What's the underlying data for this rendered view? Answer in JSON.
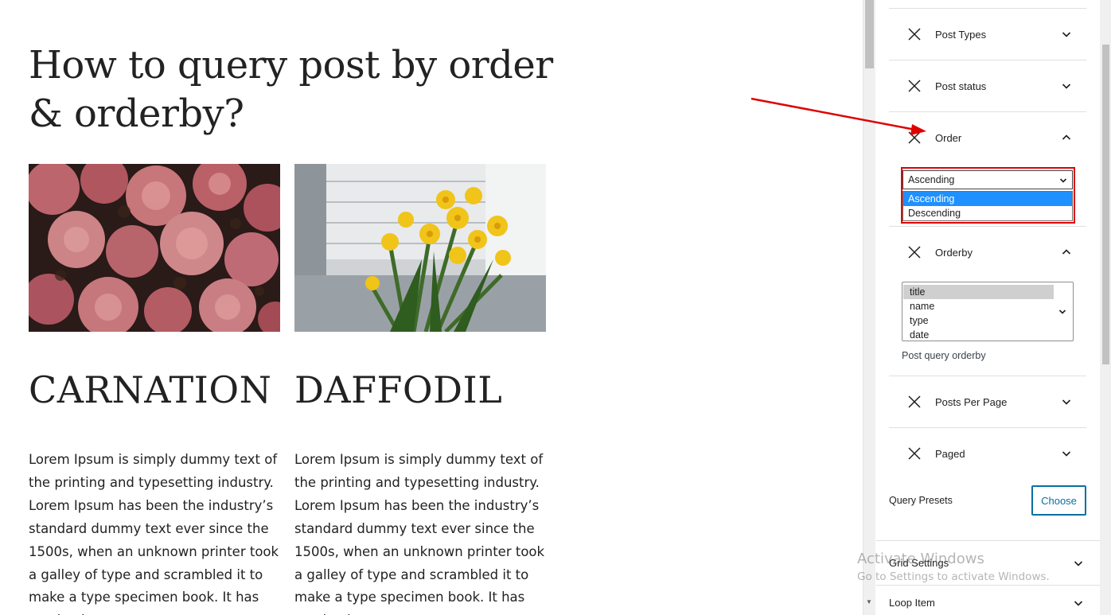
{
  "canvas": {
    "title": "How to query post by order & orderby?",
    "posts": [
      {
        "heading": "CARNATION",
        "excerpt": "Lorem Ipsum is simply dummy text of the printing and typesetting industry. Lorem Ipsum has been the industry’s standard dummy text ever since the 1500s, when an unknown printer took a galley of type and scrambled it to make a type specimen book. It has survived"
      },
      {
        "heading": "DAFFODIL",
        "excerpt": "Lorem Ipsum is simply dummy text of the printing and typesetting industry. Lorem Ipsum has been the industry’s standard dummy text ever since the 1500s, when an unknown printer took a galley of type and scrambled it to make a type specimen book. It has survived"
      }
    ]
  },
  "sidebar": {
    "panels": {
      "post_types": "Post Types",
      "post_status": "Post status",
      "order": "Order",
      "orderby": "Orderby",
      "posts_per_page": "Posts Per Page",
      "paged": "Paged"
    },
    "order_select": {
      "value": "Ascending",
      "options": [
        "Ascending",
        "Descending"
      ],
      "highlighted": "Ascending"
    },
    "orderby_list": {
      "options": [
        "title",
        "name",
        "type",
        "date"
      ],
      "selected": "title",
      "help": "Post query orderby"
    },
    "query_presets_label": "Query Presets",
    "choose_button": "Choose",
    "grid_settings": "Grid Settings",
    "loop_item": "Loop Item"
  },
  "watermark": {
    "line1": "Activate Windows",
    "line2": "Go to Settings to activate Windows."
  },
  "colors": {
    "annotation": "#e00000",
    "accent": "#0a6fa0",
    "option_highlight": "#1e90ff"
  },
  "icons": [
    "close-icon",
    "chevron-down-icon",
    "chevron-up-icon"
  ]
}
